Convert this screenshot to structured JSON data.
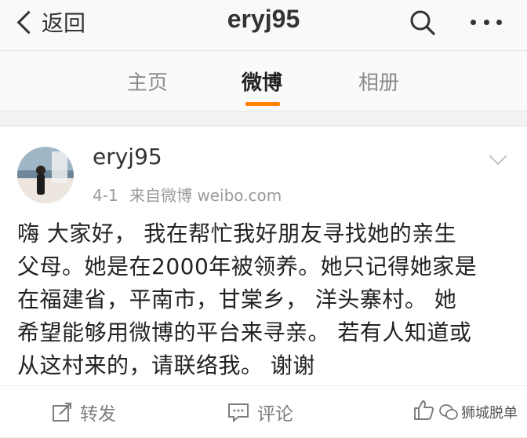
{
  "header": {
    "back_label": "返回",
    "title": "eryj95"
  },
  "tabs": [
    {
      "label": "主页"
    },
    {
      "label": "微博"
    },
    {
      "label": "相册"
    }
  ],
  "post": {
    "username": "eryj95",
    "date": "4-1",
    "source": "来自微博 weibo.com",
    "content_lines": [
      "嗨 大家好， 我在帮忙我好朋友寻找她的亲生",
      "父母。她是在2000年被领养。她只记得她家是",
      "在福建省，平南市，甘棠乡， 洋头寨村。 她",
      "希望能够用微博的平台来寻亲。 若有人知道或",
      "从这村来的，请联络我。 谢谢"
    ]
  },
  "actions": {
    "repost": "转发",
    "comment": "评论"
  },
  "watermark": "狮城脱单",
  "colors": {
    "accent": "#ff8200",
    "muted": "#9a9a9a"
  }
}
